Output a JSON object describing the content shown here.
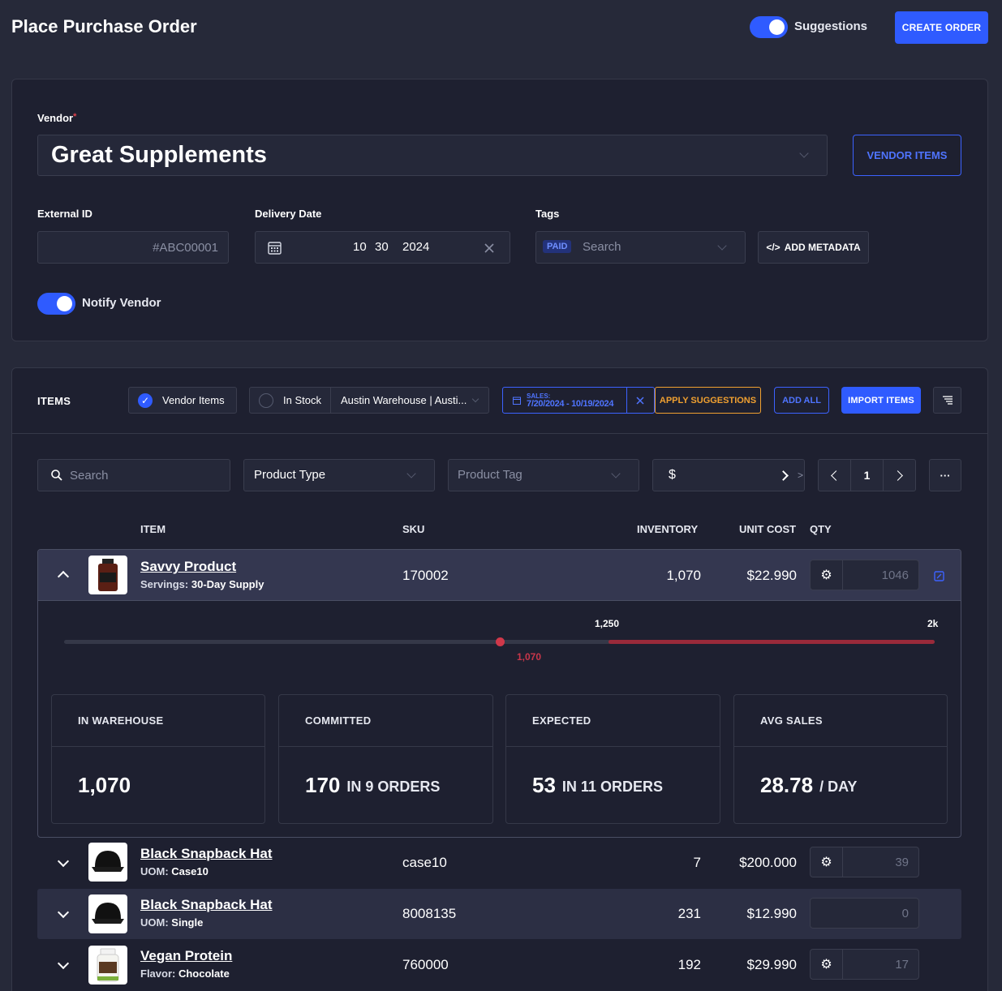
{
  "header": {
    "title": "Place Purchase Order",
    "suggestions_label": "Suggestions",
    "create_order_label": "CREATE ORDER"
  },
  "form": {
    "vendor_label": "Vendor",
    "vendor_required_mark": "*",
    "vendor_value": "Great Supplements",
    "vendor_items_button": "VENDOR ITEMS",
    "external_id_label": "External ID",
    "external_id_placeholder": "#ABC00001",
    "delivery_date_label": "Delivery Date",
    "delivery_month": "10",
    "delivery_day": "30",
    "delivery_year": "2024",
    "tags_label": "Tags",
    "tag_chip": "PAID",
    "tags_placeholder": "Search",
    "add_metadata_button": "ADD METADATA",
    "notify_vendor_label": "Notify Vendor"
  },
  "items": {
    "section_label": "ITEMS",
    "vendor_items_filter": "Vendor Items",
    "in_stock_filter": "In Stock",
    "warehouse_select": "Austin Warehouse | Austi...",
    "sales_label": "SALES:",
    "sales_range": "7/20/2024 - 10/19/2024",
    "apply_suggestions": "APPLY SUGGESTIONS",
    "add_all": "ADD ALL",
    "import_items": "IMPORT ITEMS",
    "search_placeholder": "Search",
    "product_type": "Product Type",
    "product_tag_placeholder": "Product Tag",
    "price_prefix": "$",
    "price_more": ">",
    "page": "1",
    "more_label": "···",
    "columns": {
      "item": "ITEM",
      "sku": "SKU",
      "inventory": "INVENTORY",
      "unit_cost": "UNIT COST",
      "qty": "QTY"
    },
    "expanded": {
      "name": "Savvy Product",
      "attr_key": "Servings:",
      "attr_val": "30-Day Supply",
      "sku": "170002",
      "inventory": "1,070",
      "unit_cost": "$22.990",
      "qty": "1046",
      "slider_mid_label": "1,250",
      "slider_max_label": "2k",
      "slider_current_label": "1,070",
      "slider_current_fraction": 0.5,
      "slider_mid_fraction": 0.625,
      "stats": [
        {
          "label": "IN WAREHOUSE",
          "value": "1,070",
          "suffix": ""
        },
        {
          "label": "COMMITTED",
          "value": "170",
          "suffix": "IN 9 ORDERS"
        },
        {
          "label": "EXPECTED",
          "value": "53",
          "suffix": "IN 11 ORDERS"
        },
        {
          "label": "AVG SALES",
          "value": "28.78",
          "suffix": "/ DAY"
        }
      ]
    },
    "rows": [
      {
        "name": "Black Snapback Hat",
        "attr_key": "UOM:",
        "attr_val": "Case10",
        "sku": "case10",
        "inventory": "7",
        "unit_cost": "$200.000",
        "qty": "39"
      },
      {
        "name": "Black Snapback Hat",
        "attr_key": "UOM:",
        "attr_val": "Single",
        "sku": "8008135",
        "inventory": "231",
        "unit_cost": "$12.990",
        "qty": "0"
      },
      {
        "name": "Vegan Protein",
        "attr_key": "Flavor:",
        "attr_val": "Chocolate",
        "sku": "760000",
        "inventory": "192",
        "unit_cost": "$29.990",
        "qty": "17"
      }
    ]
  },
  "colors": {
    "accent": "#2f5bff",
    "warning": "#f0a030",
    "danger": "#d0384a",
    "background": "#262939",
    "panel": "#1e2030"
  }
}
